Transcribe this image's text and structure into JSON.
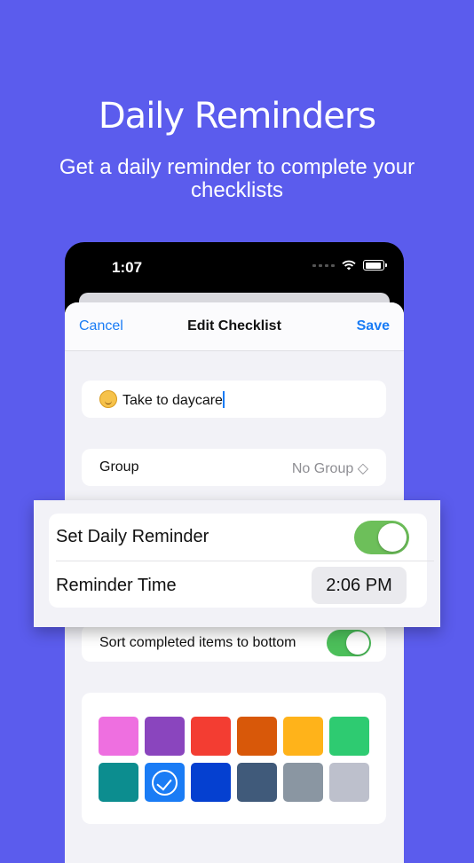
{
  "headline": "Daily Reminders",
  "subhead": "Get a daily reminder to complete your checklists",
  "status": {
    "time": "1:07"
  },
  "nav": {
    "cancel": "Cancel",
    "title": "Edit Checklist",
    "save": "Save"
  },
  "checklist": {
    "name": "Take to daycare",
    "emoji_icon": "baby-face-icon"
  },
  "group": {
    "label": "Group",
    "value": "No Group ◇"
  },
  "reminder": {
    "label": "Set Daily Reminder",
    "enabled": true,
    "time_label": "Reminder Time",
    "time": "2:06 PM"
  },
  "sort": {
    "label": "Sort completed items to bottom",
    "enabled": true
  },
  "colors": [
    "#ee6fe0",
    "#8a45be",
    "#f33d32",
    "#d85809",
    "#ffb31a",
    "#2ecb71",
    "#0c8d8f",
    "#1a7cf5",
    "#0540d0",
    "#405a7a",
    "#8a96a2",
    "#bdc0cc"
  ],
  "selected_color_index": 7
}
